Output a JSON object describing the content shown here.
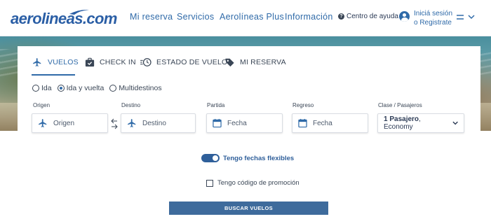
{
  "header": {
    "logo": "aerolineas.com",
    "nav": [
      "Mi reserva",
      "Servicios",
      "Aerolíneas Plus",
      "Información"
    ],
    "help": "Centro de ayuda",
    "login_line1": "Iniciá sesión",
    "login_line2": "o Registrate"
  },
  "tabs": [
    "VUELOS",
    "CHECK IN",
    "ESTADO DE VUELO",
    "MI RESERVA"
  ],
  "trip_types": [
    "Ida",
    "Ida y vuelta",
    "Multidestinos"
  ],
  "selected_trip_type": "Ida y vuelta",
  "fields": {
    "origin": {
      "label": "Origen",
      "placeholder": "Origen"
    },
    "destination": {
      "label": "Destino",
      "placeholder": "Destino"
    },
    "departure": {
      "label": "Partida",
      "placeholder": "Fecha"
    },
    "return": {
      "label": "Regreso",
      "placeholder": "Fecha"
    },
    "class": {
      "label": "Clase / Pasajeros",
      "passengers": "1 Pasajero",
      "cabin": ", Economy"
    }
  },
  "flexible_dates": {
    "label": "Tengo fechas flexibles",
    "checked": true
  },
  "promo": {
    "label": "Tengo código de promoción",
    "checked": false
  },
  "search_button": "BUSCAR VUELOS",
  "colors": {
    "brand": "#2f6aa8",
    "button": "#3e6b9c",
    "toggle": "#2f5f9a"
  }
}
